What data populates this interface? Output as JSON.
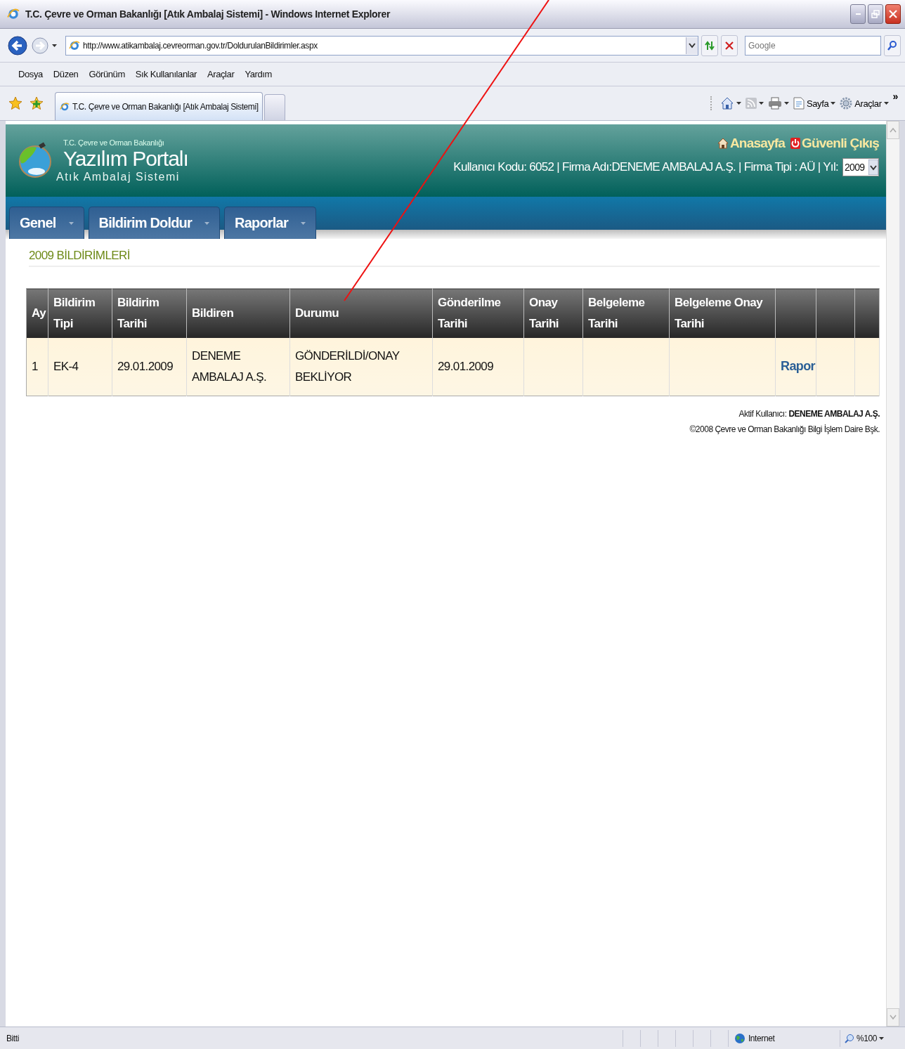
{
  "window": {
    "title": "T.C. Çevre ve Orman Bakanlığı [Atık Ambalaj Sistemi] - Windows Internet Explorer"
  },
  "address_bar": {
    "url": "http://www.atikambalaj.cevreorman.gov.tr/DoldurulanBildirimler.aspx",
    "search_placeholder": "Google"
  },
  "menu": [
    "Dosya",
    "Düzen",
    "Görünüm",
    "Sık Kullanılanlar",
    "Araçlar",
    "Yardım"
  ],
  "browser_tabs": [
    {
      "label": "T.C. Çevre ve Orman Bakanlığı [Atık Ambalaj Sistemi]",
      "selected": true
    }
  ],
  "command_bar": [
    {
      "kind": "home"
    },
    {
      "kind": "feed"
    },
    {
      "kind": "print"
    },
    {
      "kind": "page",
      "label": "Sayfa"
    },
    {
      "kind": "tools",
      "label": "Araçlar"
    },
    {
      "kind": "more",
      "label": "»"
    }
  ],
  "site_header": {
    "ministry": "T.C. Çevre ve Orman Bakanlığı",
    "title": "Yazılım Portalı",
    "subtitle": "Atık Ambalaj Sistemi",
    "links": [
      {
        "kind": "home",
        "label": "Anasayfa"
      },
      {
        "kind": "logout",
        "label": "Güvenli Çıkış"
      }
    ],
    "user_info": "Kullanıcı Kodu: 6052 | Firma Adı:DENEME AMBALAJ A.Ş. | Firma Tipi : AÜ | Yıl:",
    "year": "2009"
  },
  "nav": [
    "Genel",
    "Bildirim Doldur",
    "Raporlar"
  ],
  "section_title": "2009 BİLDİRİMLERİ",
  "table": {
    "columns": [
      "Ay",
      "Bildirim Tipi",
      "Bildirim Tarihi",
      "Bildiren",
      "Durumu",
      "Gönderilme Tarihi",
      "Onay Tarihi",
      "Belgeleme Tarihi",
      "Belgeleme Onay Tarihi"
    ],
    "rows": [
      {
        "cells": [
          "1",
          "EK-4",
          "29.01.2009",
          "DENEME AMBALAJ A.Ş.",
          "GÖNDERİLDİ/ONAY BEKLİYOR",
          "29.01.2009"
        ],
        "link": "Rapor"
      }
    ]
  },
  "footer": {
    "active_user": "Aktif Kullanıcı: **DENEME AMBALAJ A.Ş.**",
    "copyright": "©2008 Çevre ve Orman Bakanlığı Bilgi İşlem Daire Bşk."
  },
  "status_bar": {
    "status": "Bitti",
    "zone": "Internet",
    "zoom": "%100"
  }
}
